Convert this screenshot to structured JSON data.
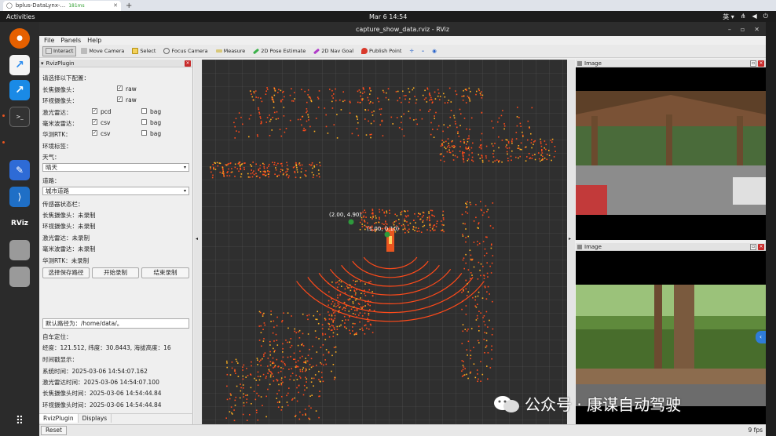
{
  "browser_tab": {
    "title": "bplus-DataLynx-...",
    "latency": "181ms"
  },
  "topbar": {
    "activities": "Activities",
    "clock": "Mar 6  14:54",
    "lang": "英 ▾"
  },
  "window": {
    "title": "capture_show_data.rviz - RViz"
  },
  "menu": {
    "file": "File",
    "panels": "Panels",
    "help": "Help"
  },
  "toolbar": {
    "interact": "Interact",
    "move_camera": "Move Camera",
    "select": "Select",
    "focus_camera": "Focus Camera",
    "measure": "Measure",
    "pose_estimate": "2D Pose Estimate",
    "nav_goal": "2D Nav Goal",
    "publish_point": "Publish Point"
  },
  "plugin": {
    "title": "RvizPlugin",
    "config_label": "请选择以下配置：",
    "sensors": [
      {
        "name": "长焦摄像头：",
        "opt1": "raw"
      },
      {
        "name": "环视摄像头：",
        "opt1": "raw"
      },
      {
        "name": "激光雷达：",
        "opt1": "pcd",
        "opt2": "bag"
      },
      {
        "name": "毫米波雷达：",
        "opt1": "csv",
        "opt2": "bag"
      },
      {
        "name": "华测RTK：",
        "opt1": "csv",
        "opt2": "bag"
      }
    ],
    "env_label": "环境标签：",
    "weather_label": "天气：",
    "weather_value": "晴天",
    "road_label": "道路：",
    "road_value": "城市道路",
    "status_label": "传感器状态栏：",
    "status": [
      "长焦摄像头：未录制",
      "环视摄像头：未录制",
      "激光雷达：未录制",
      "毫米波雷达：未录制",
      "华测RTK：未录制"
    ],
    "btn_path": "选择保存路径",
    "btn_start": "开始录制",
    "btn_stop": "结束录制",
    "default_path": "默认路径为：/home/data/。",
    "loc_label": "自车定位：",
    "loc_value": "经度：121.512, 纬度：30.8443, 海拔高度：16",
    "ts_label": "时间戳显示：",
    "ts": [
      "系统时间：2025-03-06 14:54:07.162",
      "激光雷达时间：2025-03-06 14:54:07.100",
      "长焦摄像头时间：2025-03-06 14:54:44.84",
      "环视摄像头时间：2025-03-06 14:54:44.84",
      "毫米波雷达时间：2025-03-06 14:54:44.57",
      "RTK时间：2025-03-06 14:54:44.128"
    ],
    "tab_plugin": "RvizPlugin",
    "tab_displays": "Displays"
  },
  "view": {
    "label1": "(2.00, 4.90)",
    "label2": "(1.00, 0.10)"
  },
  "image_panels": {
    "title1": "Image",
    "title2": "Image"
  },
  "status": {
    "reset": "Reset",
    "fps": "9 fps"
  },
  "watermark": "公众号 · 康谋自动驾驶",
  "colors": {
    "points": "#ff4a1a",
    "grid": "#555555",
    "accent": "#2f7cd9"
  }
}
